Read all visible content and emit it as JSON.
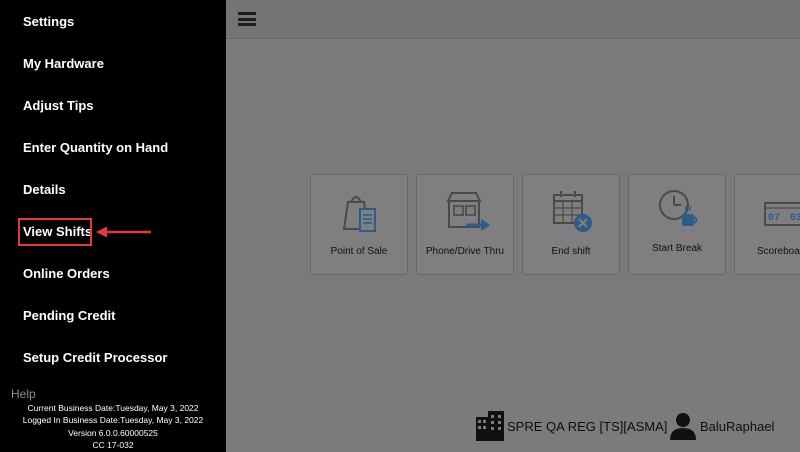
{
  "sidebar": {
    "items": [
      {
        "label": "Settings"
      },
      {
        "label": "My Hardware"
      },
      {
        "label": "Adjust Tips"
      },
      {
        "label": "Enter Quantity on Hand"
      },
      {
        "label": "Details"
      },
      {
        "label": "View Shifts"
      },
      {
        "label": "Online Orders"
      },
      {
        "label": "Pending Credit"
      },
      {
        "label": "Setup Credit Processor"
      }
    ],
    "help_label": "Help",
    "footer": {
      "current_business_date": "Current Business Date:Tuesday, May 3, 2022",
      "logged_in_business_date": "Logged In Business Date:Tuesday, May 3, 2022",
      "version": "Version 6.0.0.60000525",
      "cc": "CC 17-032"
    }
  },
  "main": {
    "tiles": [
      {
        "label": "Point of Sale",
        "icon": "point-of-sale-icon"
      },
      {
        "label": "Phone/Drive Thru",
        "icon": "phone-drive-thru-icon"
      },
      {
        "label": "End shift",
        "icon": "end-shift-icon"
      },
      {
        "label": "Start Break",
        "icon": "start-break-icon"
      },
      {
        "label": "Scoreboa",
        "icon": "scoreboard-icon"
      }
    ],
    "status": {
      "store": "SPRE QA REG [TS][ASMA]",
      "user": "BaluRaphael"
    }
  },
  "colors": {
    "highlight": "#e0393e",
    "icon_blue": "#2b5c8a",
    "overlay": "#7b7b7b"
  }
}
